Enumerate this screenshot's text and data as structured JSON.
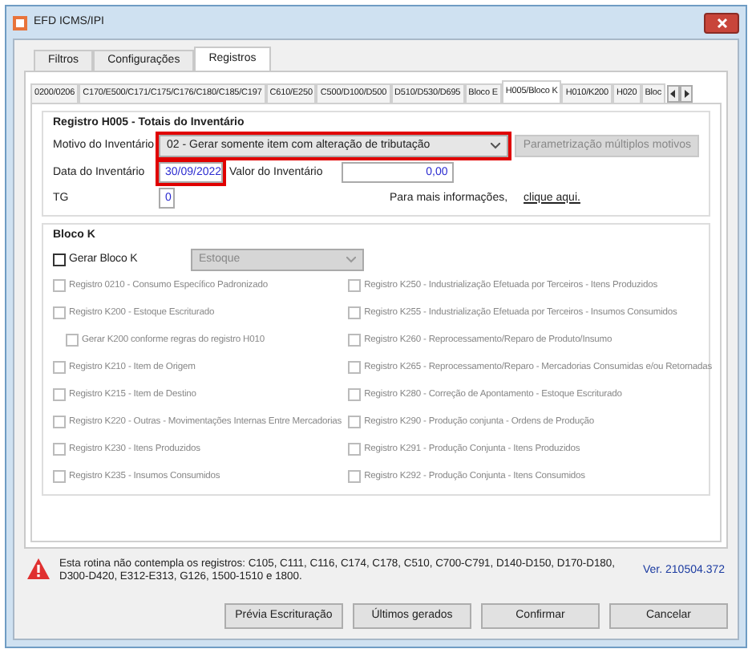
{
  "window": {
    "title": "EFD ICMS/IPI"
  },
  "tabs": [
    {
      "label": "Filtros",
      "selected": false
    },
    {
      "label": "Configurações",
      "selected": false
    },
    {
      "label": "Registros",
      "selected": true
    }
  ],
  "subtabs": [
    {
      "label": "0200/0206",
      "selected": false
    },
    {
      "label": "C170/E500/C171/C175/C176/C180/C185/C197",
      "selected": false
    },
    {
      "label": "C610/E250",
      "selected": false
    },
    {
      "label": "C500/D100/D500",
      "selected": false
    },
    {
      "label": "D510/D530/D695",
      "selected": false
    },
    {
      "label": "Bloco E",
      "selected": false
    },
    {
      "label": "H005/Bloco K",
      "selected": true
    },
    {
      "label": "H010/K200",
      "selected": false
    },
    {
      "label": "H020",
      "selected": false
    },
    {
      "label": "Bloc",
      "selected": false
    }
  ],
  "h005": {
    "title": "Registro H005 - Totais do Inventário",
    "motivo": {
      "label": "Motivo do Inventário",
      "value": "02 - Gerar somente item com alteração de tributação",
      "highlighted": true
    },
    "param_button": {
      "label": "Parametrização múltiplos motivos",
      "disabled": true
    },
    "data": {
      "label": "Data do Inventário",
      "value": "30/09/2022",
      "highlighted": true
    },
    "valor": {
      "label": "Valor do Inventário",
      "value": "0,00"
    },
    "tg": {
      "label": "TG",
      "value": "0"
    },
    "info": {
      "text": "Para mais informações,",
      "link": "clique aqui."
    }
  },
  "bloco_k": {
    "title": "Bloco K",
    "gerar": {
      "label": "Gerar Bloco K",
      "checked": false,
      "disabled": false
    },
    "combo": {
      "value": "Estoque",
      "disabled": true
    },
    "left": [
      {
        "label": "Registro 0210 - Consumo Específico Padronizado",
        "checked": false,
        "disabled": true,
        "indented": false
      },
      {
        "label": "Registro K200 - Estoque Escriturado",
        "checked": false,
        "disabled": true,
        "indented": false
      },
      {
        "label": "Gerar K200 conforme regras do registro H010",
        "checked": false,
        "disabled": true,
        "indented": true
      },
      {
        "label": "Registro K210 - Item de Origem",
        "checked": false,
        "disabled": true,
        "indented": false
      },
      {
        "label": "Registro K215 - Item de Destino",
        "checked": false,
        "disabled": true,
        "indented": false
      },
      {
        "label": "Registro K220 - Outras - Movimentações Internas Entre Mercadorias",
        "checked": false,
        "disabled": true,
        "indented": false
      },
      {
        "label": "Registro K230 - Itens Produzidos",
        "checked": false,
        "disabled": true,
        "indented": false
      },
      {
        "label": "Registro K235 - Insumos Consumidos",
        "checked": false,
        "disabled": true,
        "indented": false
      }
    ],
    "right": [
      {
        "label": "Registro K250 - Industrialização Efetuada por Terceiros - Itens Produzidos",
        "checked": false,
        "disabled": true
      },
      {
        "label": "Registro K255 - Industrialização Efetuada por Terceiros - Insumos Consumidos",
        "checked": false,
        "disabled": true
      },
      {
        "label": "Registro K260 - Reprocessamento/Reparo de Produto/Insumo",
        "checked": false,
        "disabled": true
      },
      {
        "label": "Registro K265 - Reprocessamento/Reparo - Mercadorias Consumidas e/ou Retornadas",
        "checked": false,
        "disabled": true
      },
      {
        "label": "Registro K280 - Correção de Apontamento - Estoque Escriturado",
        "checked": false,
        "disabled": true
      },
      {
        "label": "Registro K290 - Produção conjunta - Ordens de Produção",
        "checked": false,
        "disabled": true
      },
      {
        "label": "Registro K291 - Produção Conjunta - Itens Produzidos",
        "checked": false,
        "disabled": true
      },
      {
        "label": "Registro K292 - Produção Conjunta - Itens Consumidos",
        "checked": false,
        "disabled": true
      }
    ]
  },
  "footer": {
    "warning": "Esta rotina não contempla os registros: C105, C111, C116, C174, C178, C510, C700-C791, D140-D150, D170-D180, D300-D420, E312-E313, G126, 1500-1510 e 1800.",
    "version": "Ver. 210504.372"
  },
  "buttons": [
    {
      "label": "Prévia Escrituração"
    },
    {
      "label": "Últimos gerados"
    },
    {
      "label": "Confirmar"
    },
    {
      "label": "Cancelar"
    }
  ]
}
